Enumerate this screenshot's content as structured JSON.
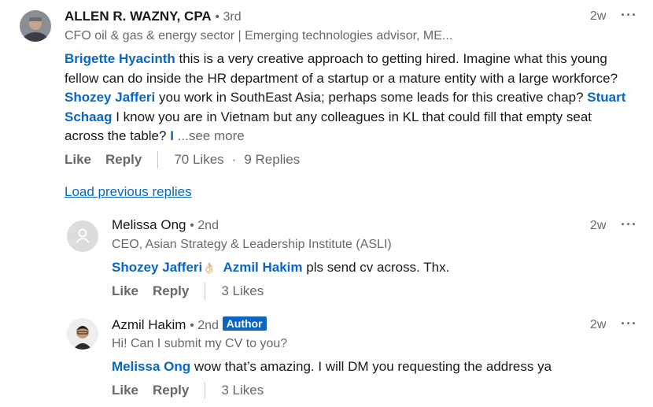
{
  "comments": [
    {
      "author": "ALLEN R. WAZNY, CPA",
      "degree": "• 3rd",
      "headline": "CFO oil & gas & energy sector | Emerging technologies advisor, ME...",
      "time": "2w",
      "more": "···",
      "body": {
        "m1": "Brigette Hyacinth",
        "t1": " this is a very creative approach to getting hired. Imagine what this young fellow can do inside the HR department of a startup or a mature entity with a large workforce? ",
        "m2": "Shozey Jafferi",
        "t2": " you work in SouthEast Asia; perhaps some leads for this creative chap? ",
        "m3": "Stuart Schaag",
        "t3": " I know you are in Vietnam but any colleagues in KL that could  fill that empty seat across the table? ",
        "m4": "I",
        "see_more": " ...see more"
      },
      "like": "Like",
      "reply": "Reply",
      "likes": "70 Likes",
      "sep": "·",
      "replies": "9 Replies"
    }
  ],
  "load_previous": "Load previous replies",
  "replies": [
    {
      "author": "Melissa Ong",
      "degree": "• 2nd",
      "headline": "CEO, Asian Strategy & Leadership Institute (ASLI)",
      "time": "2w",
      "more": "···",
      "m1": "Shozey Jafferi",
      "emoji": "👌🏻",
      "m2": "Azmil Hakim",
      "text": " pls send cv across. Thx.",
      "like": "Like",
      "reply": "Reply",
      "likes": "3 Likes"
    },
    {
      "author": "Azmil Hakim",
      "degree": "• 2nd",
      "badge": "Author",
      "headline": "Hi! Can I submit my CV to you?",
      "time": "2w",
      "more": "···",
      "m1": "Melissa Ong",
      "text": " wow that’s amazing. I will DM you requesting the address ya",
      "like": "Like",
      "reply": "Reply",
      "likes": "3 Likes"
    }
  ],
  "colors": {
    "link": "#0a66c2",
    "muted": "#666666",
    "text": "#1a1a1a"
  },
  "icons": [
    "photo-avatar",
    "default-person-avatar",
    "more-options-icon"
  ]
}
